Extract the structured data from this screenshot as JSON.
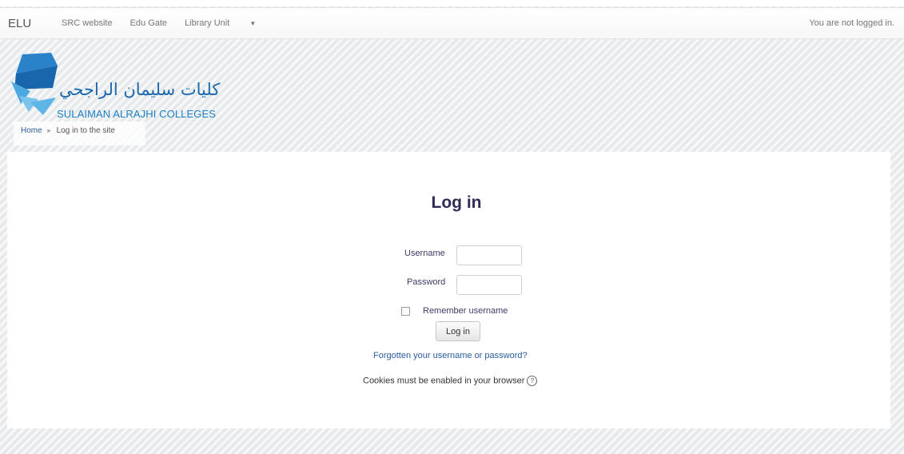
{
  "navbar": {
    "brand": "ELU",
    "links": [
      "SRC website",
      "Edu Gate",
      "Library Unit"
    ],
    "status": "You are not logged in."
  },
  "logo": {
    "arabic": "كليات سليمان الراجحي",
    "english": "SULAIMAN ALRAJHI COLLEGES"
  },
  "breadcrumb": {
    "home": "Home",
    "current": "Log in to the site"
  },
  "login": {
    "title": "Log in",
    "username_label": "Username",
    "username_value": "",
    "password_label": "Password",
    "password_value": "",
    "remember_label": "Remember username",
    "button_label": "Log in",
    "forgot_link": "Forgotten your username or password?",
    "cookies_text": "Cookies must be enabled in your browser"
  },
  "colors": {
    "title": "#2c2c57",
    "link": "#2a5d9e",
    "logo_blue": "#1a68ae"
  },
  "icons": {
    "nav_dropdown": "caret-down-icon",
    "breadcrumb_separator": "triangle-right-icon",
    "help": "question-circle-icon"
  }
}
